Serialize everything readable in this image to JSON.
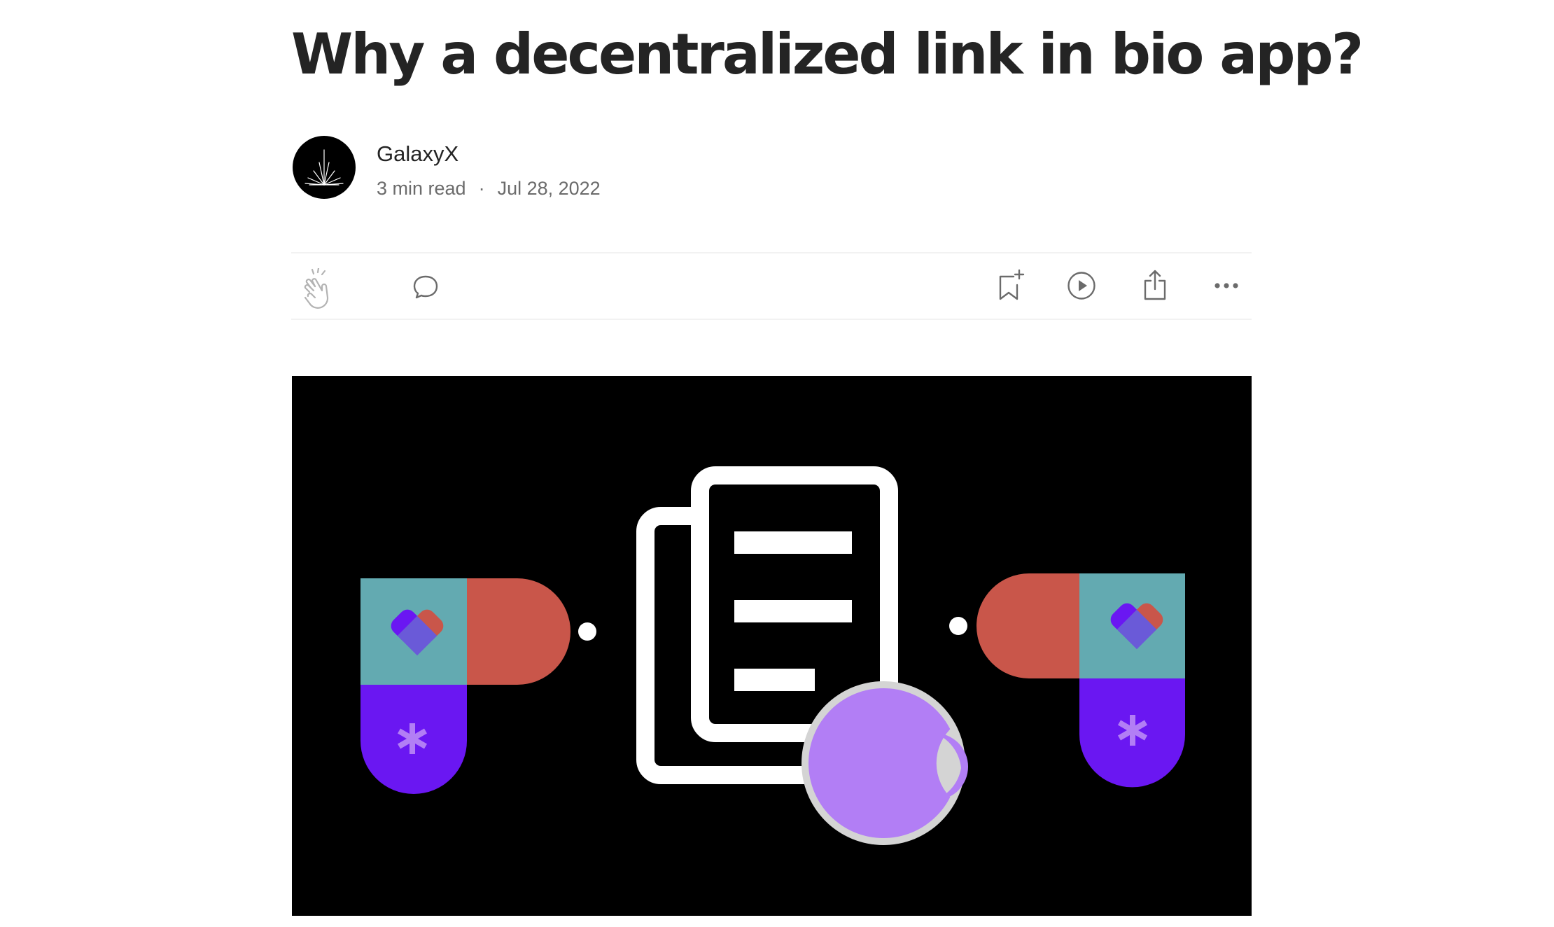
{
  "article": {
    "title": "Why a decentralized link in bio app?",
    "author": "GalaxyX",
    "read_time": "3 min read",
    "separator": "·",
    "date": "Jul 28, 2022"
  },
  "actions": {
    "clap_icon": "clap-icon",
    "comment_icon": "comment-icon",
    "bookmark_icon": "bookmark-add-icon",
    "listen_icon": "play-icon",
    "share_icon": "share-icon",
    "more_icon": "more-icon"
  },
  "hero": {
    "background_color": "#000000",
    "colors": {
      "teal": "#63aab1",
      "coral": "#c9564a",
      "purple": "#6a17f2",
      "lavender": "#b27ef5",
      "grey": "#d4d4d4"
    }
  }
}
